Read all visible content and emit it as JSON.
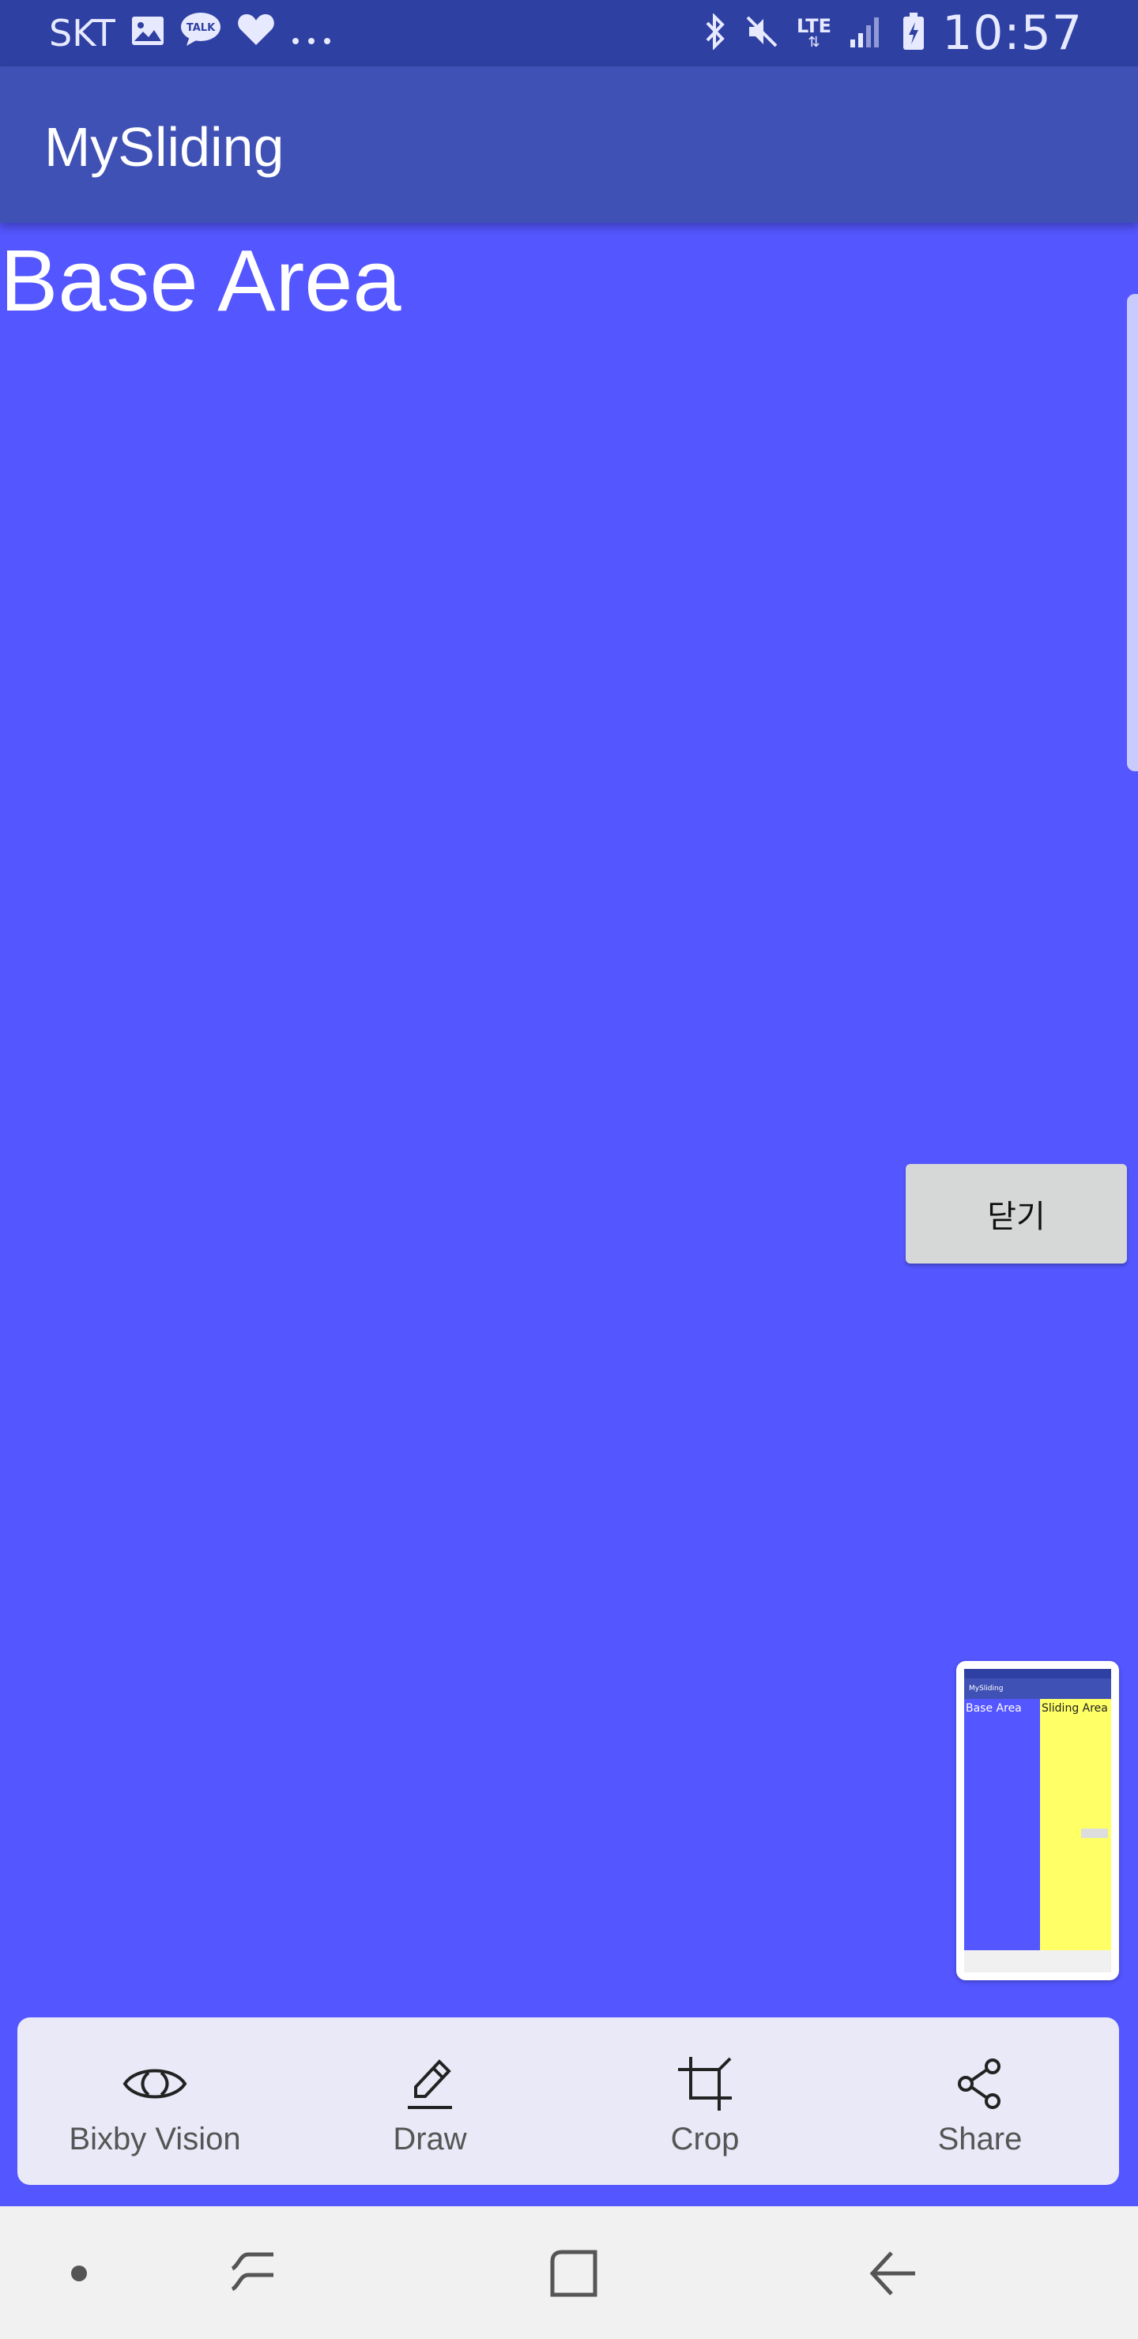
{
  "status_bar": {
    "carrier": "SKT",
    "notification_icons": [
      "image-icon",
      "talk-icon",
      "heart-icon",
      "more-dots-icon"
    ],
    "talk_badge": "TALK",
    "system_icons": [
      "bluetooth-icon",
      "mute-icon",
      "lte-icon",
      "signal-icon",
      "battery-charging-icon"
    ],
    "lte_label": "LTE",
    "time": "10:57"
  },
  "app_bar": {
    "title": "MySliding"
  },
  "main": {
    "base_area_label": "Base Area",
    "close_button_label": "닫기"
  },
  "screenshot_thumbnail": {
    "app_title": "MySliding",
    "base_area_label": "Base Area",
    "sliding_area_label": "Sliding Area"
  },
  "capture_toolbar": {
    "items": [
      {
        "label": "Bixby Vision",
        "icon": "eye-icon"
      },
      {
        "label": "Draw",
        "icon": "pencil-icon"
      },
      {
        "label": "Crop",
        "icon": "crop-icon"
      },
      {
        "label": "Share",
        "icon": "share-icon"
      }
    ]
  },
  "nav_bar": {
    "items": [
      "dot-icon",
      "recents-icon",
      "home-icon",
      "back-icon"
    ]
  },
  "colors": {
    "status_bar": "#2f40a3",
    "app_bar": "#3f51b5",
    "base_area": "#5456ff",
    "sliding_area": "#ffff66",
    "button": "#d6d7d7"
  }
}
